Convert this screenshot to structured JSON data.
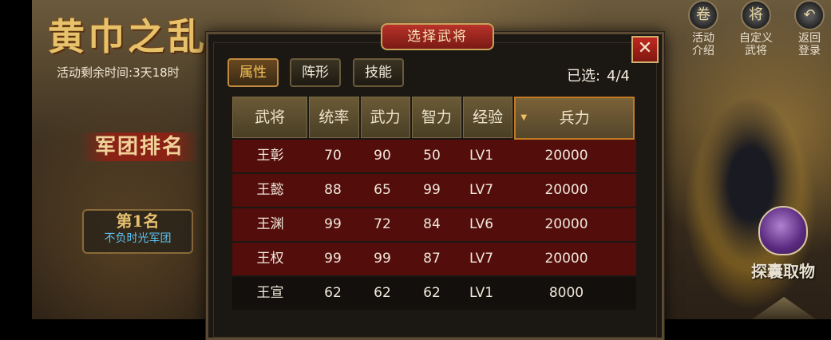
{
  "background": {
    "event_title": "黄巾之乱",
    "countdown_label": "活动剩余时间:",
    "countdown_value": "3天18时",
    "rank_title": "军团排名",
    "rank_place": "第1名",
    "rank_team": "不负时光军团"
  },
  "top_icons": [
    {
      "label": "活动\n介绍",
      "icon": "scroll-icon"
    },
    {
      "label": "自定义\n武将",
      "icon": "general-icon"
    },
    {
      "label": "返回\n登录",
      "icon": "return-arrow-icon"
    }
  ],
  "side_icon": {
    "label": "探囊取物",
    "icon": "treasure-bag-icon"
  },
  "dialog": {
    "title": "选择武将",
    "close_symbol": "✕",
    "tabs": [
      {
        "label": "属性",
        "active": true
      },
      {
        "label": "阵形",
        "active": false
      },
      {
        "label": "技能",
        "active": false
      }
    ],
    "selected_label": "已选:",
    "selected_value": "4/4",
    "table": {
      "headers": [
        "武将",
        "统率",
        "武力",
        "智力",
        "经验",
        "兵力"
      ],
      "sorted_column": "兵力",
      "rows": [
        {
          "selected": true,
          "cells": [
            "王彰",
            "70",
            "90",
            "50",
            "LV1",
            "20000"
          ]
        },
        {
          "selected": true,
          "cells": [
            "王懿",
            "88",
            "65",
            "99",
            "LV7",
            "20000"
          ]
        },
        {
          "selected": true,
          "cells": [
            "王渊",
            "99",
            "72",
            "84",
            "LV6",
            "20000"
          ]
        },
        {
          "selected": true,
          "cells": [
            "王权",
            "99",
            "99",
            "87",
            "LV7",
            "20000"
          ]
        },
        {
          "selected": false,
          "cells": [
            "王宣",
            "62",
            "62",
            "62",
            "LV1",
            "8000"
          ]
        }
      ]
    }
  },
  "colors": {
    "selected_row": "#530d0b",
    "title_red": "#b8322a",
    "active_tab_text": "#f7c45a"
  }
}
